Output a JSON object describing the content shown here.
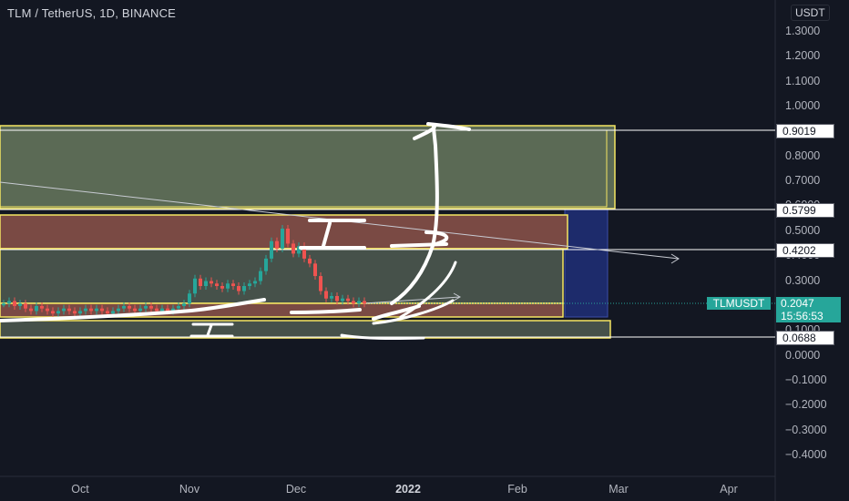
{
  "header": {
    "title": "TLM / TetherUS, 1D, BINANCE",
    "unit_badge": "USDT"
  },
  "y_axis": {
    "ticks": [
      "1.3000",
      "1.2000",
      "1.1000",
      "1.0000",
      "0.9000",
      "0.8000",
      "0.7000",
      "0.6000",
      "0.5000",
      "0.4000",
      "0.3000",
      "0.2000",
      "0.1000",
      "0.0000",
      "−0.1000",
      "−0.2000",
      "−0.3000",
      "−0.4000"
    ]
  },
  "x_axis": {
    "ticks": [
      {
        "label": "Oct",
        "major": false
      },
      {
        "label": "Nov",
        "major": false
      },
      {
        "label": "Dec",
        "major": false
      },
      {
        "label": "2022",
        "major": true
      },
      {
        "label": "Feb",
        "major": false
      },
      {
        "label": "Mar",
        "major": false
      },
      {
        "label": "Apr",
        "major": false
      }
    ]
  },
  "levels": [
    {
      "label": "0.9019",
      "value": 0.9019
    },
    {
      "label": "0.5799",
      "value": 0.5799
    },
    {
      "label": "0.4202",
      "value": 0.4202
    },
    {
      "label": "0.0688",
      "value": 0.0688
    }
  ],
  "current": {
    "symbol": "TLMUSDT",
    "price": "0.2047",
    "countdown": "15:56:53"
  },
  "colors": {
    "background": "#131722",
    "up": "#26a69a",
    "down": "#ef5350",
    "zone_green": "#5b6a55",
    "zone_red": "#7a4a44",
    "zone_border": "#f5e663",
    "projection_blue": "#1c2a6a"
  }
}
